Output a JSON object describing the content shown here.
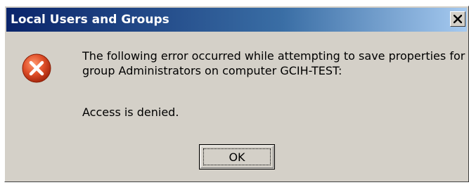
{
  "window": {
    "title": "Local Users and Groups",
    "close_icon": "close-icon"
  },
  "dialog": {
    "icon": "error-icon",
    "message_line1": "The following error occurred while attempting to save properties for",
    "message_line2": "group Administrators on computer GCIH-TEST:",
    "detail": "Access is denied.",
    "ok_label": "OK"
  },
  "colors": {
    "title_gradient_start": "#0a246a",
    "title_gradient_end": "#a6caf0",
    "dialog_face": "#d4d0c8",
    "error_red": "#e0502a"
  }
}
